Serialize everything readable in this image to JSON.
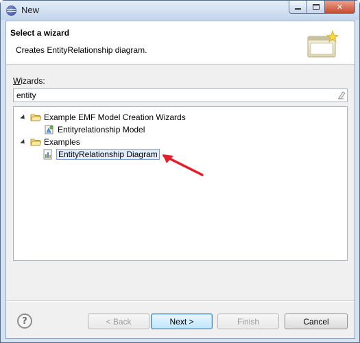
{
  "window": {
    "title": "New"
  },
  "header": {
    "title": "Select a wizard",
    "description": "Creates EntityRelationship diagram."
  },
  "wizards": {
    "label_mnemonic": "W",
    "label_rest": "izards:",
    "filter_value": "entity",
    "tree": [
      {
        "label": "Example EMF Model Creation Wizards",
        "icon": "folder-icon",
        "expanded": true
      },
      {
        "label": "Entityrelationship Model",
        "icon": "model-icon"
      },
      {
        "label": "Examples",
        "icon": "folder-icon",
        "expanded": true
      },
      {
        "label": "EntityRelationship Diagram",
        "icon": "diagram-icon",
        "selected": true
      }
    ]
  },
  "buttons": {
    "help": "?",
    "back": "< Back",
    "next": "Next >",
    "finish": "Finish",
    "cancel": "Cancel"
  },
  "colors": {
    "selection_bg": "#e3ecf8",
    "selection_border": "#7aa2d6",
    "annotation_arrow": "#e0202a"
  }
}
